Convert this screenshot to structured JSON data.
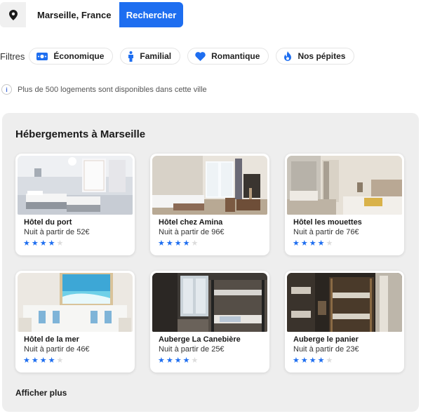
{
  "search": {
    "location_value": "Marseille, France",
    "button_label": "Rechercher"
  },
  "filters": {
    "label": "Filtres",
    "chips": [
      {
        "label": "Économique",
        "icon": "money-icon"
      },
      {
        "label": "Familial",
        "icon": "person-icon"
      },
      {
        "label": "Romantique",
        "icon": "heart-icon"
      },
      {
        "label": "Nos pépites",
        "icon": "flame-icon"
      }
    ]
  },
  "info": {
    "icon": "info-icon",
    "text": "Plus de 500 logements sont disponibles dans cette ville"
  },
  "listings": {
    "title": "Hébergements à Marseille",
    "show_more": "Afficher plus",
    "items": [
      {
        "name": "Hôtel du port",
        "price": "Nuit à partir de 52€",
        "rating": 4,
        "max_rating": 5
      },
      {
        "name": "Hôtel chez Amina",
        "price": "Nuit à partir de 96€",
        "rating": 4,
        "max_rating": 5
      },
      {
        "name": "Hôtel les mouettes",
        "price": "Nuit à partir de 76€",
        "rating": 4,
        "max_rating": 5
      },
      {
        "name": "Hôtel de la mer",
        "price": "Nuit à partir de 46€",
        "rating": 4,
        "max_rating": 5
      },
      {
        "name": "Auberge La Canebière",
        "price": "Nuit à partir de 25€",
        "rating": 4,
        "max_rating": 5
      },
      {
        "name": "Auberge le panier",
        "price": "Nuit à partir de 23€",
        "rating": 4,
        "max_rating": 5
      }
    ]
  },
  "colors": {
    "accent": "#1e6ef0",
    "panel_bg": "#eeeeee",
    "star_empty": "#dcdcdc"
  }
}
